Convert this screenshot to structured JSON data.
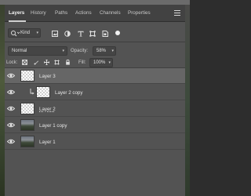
{
  "tabs": [
    {
      "label": "Layers",
      "active": true
    },
    {
      "label": "History",
      "active": false
    },
    {
      "label": "Paths",
      "active": false
    },
    {
      "label": "Actions",
      "active": false
    },
    {
      "label": "Channels",
      "active": false
    },
    {
      "label": "Properties",
      "active": false
    }
  ],
  "filter": {
    "kind_label": "Kind",
    "icons": [
      "pixel-filter-icon",
      "adjustment-filter-icon",
      "type-filter-icon",
      "shape-filter-icon",
      "smart-object-filter-icon"
    ]
  },
  "blend": {
    "mode": "Normal",
    "opacity_label": "Opacity:",
    "opacity_value": "58%"
  },
  "lock": {
    "label": "Lock:",
    "icons": [
      "lock-transparent-icon",
      "lock-image-icon",
      "lock-position-icon",
      "lock-artboard-icon",
      "lock-all-icon"
    ],
    "fill_label": "Fill:",
    "fill_value": "100%"
  },
  "layers": [
    {
      "name": "Layer 3",
      "thumb": "transparent",
      "selected": true
    },
    {
      "name": "Layer 2 copy",
      "thumb": "transparent",
      "selected": false,
      "clipped": true
    },
    {
      "name": "Layer 2",
      "thumb": "transparent",
      "selected": false
    },
    {
      "name": "Layer 1 copy",
      "thumb": "photo",
      "selected": false
    },
    {
      "name": "Layer 1",
      "thumb": "photo",
      "selected": false
    }
  ],
  "colors": {
    "panel_bg": "#535353",
    "tab_bar_bg": "#424242",
    "selected_layer_bg": "#666666"
  }
}
